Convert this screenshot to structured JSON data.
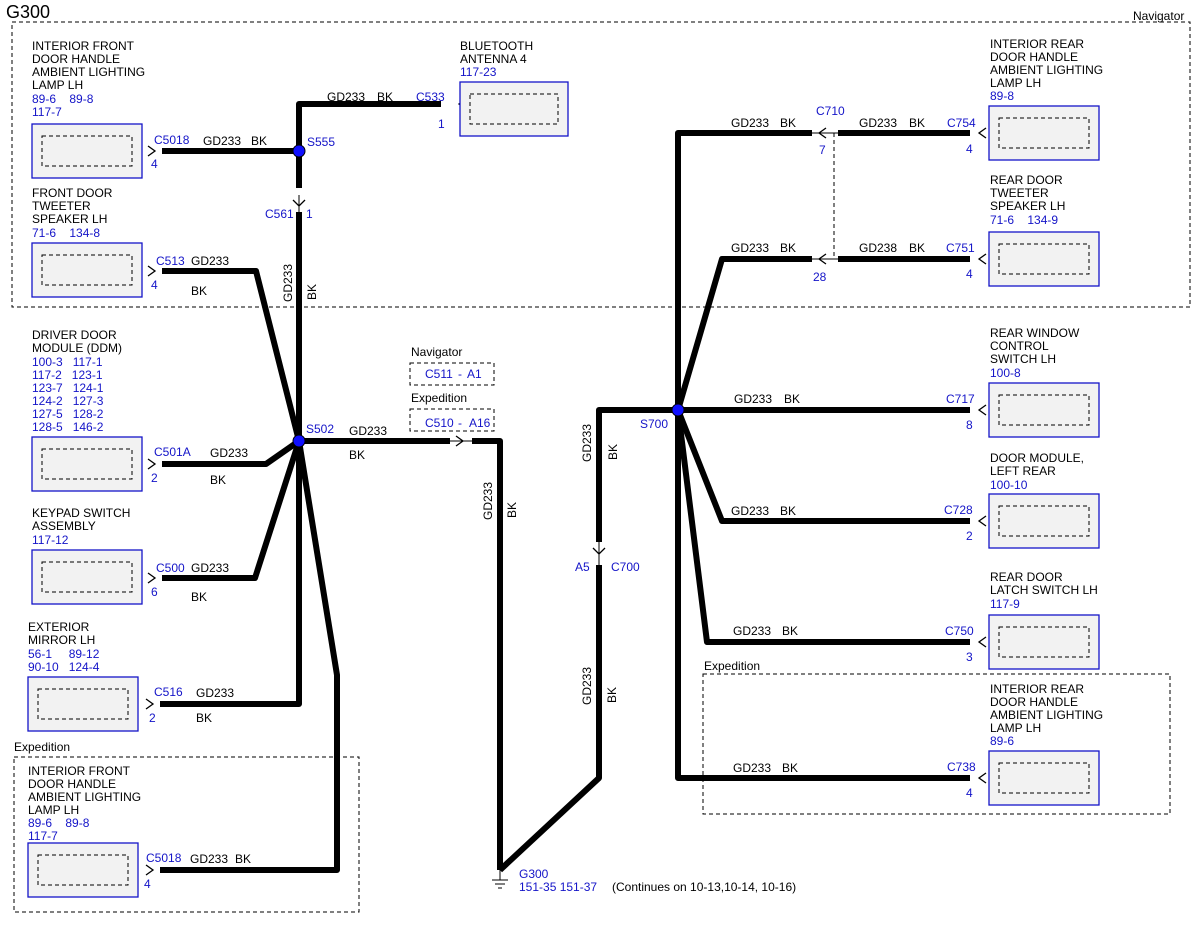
{
  "title": "G300",
  "region_labels": {
    "navigator_top": "Navigator",
    "expedition_left": "Expedition",
    "expedition_right": "Expedition"
  },
  "wire": {
    "circuit": "GD233",
    "color": "BK",
    "alt_circuit": "GD238"
  },
  "components": {
    "ifdh_lh": {
      "lines": [
        "INTERIOR FRONT",
        "DOOR HANDLE",
        "AMBIENT LIGHTING",
        "LAMP LH"
      ],
      "refs": [
        "89-6    89-8",
        "117-7"
      ],
      "connector": "C5018",
      "pin": "4"
    },
    "bt_antenna": {
      "lines": [
        "BLUETOOTH",
        "ANTENNA 4"
      ],
      "refs": [
        "117-23"
      ],
      "connector": "C533",
      "pin": "1"
    },
    "tweeter_lh": {
      "lines": [
        "FRONT DOOR",
        "TWEETER",
        "SPEAKER LH"
      ],
      "refs": [
        "71-6    134-8"
      ],
      "connector": "C513",
      "pin": "4"
    },
    "ddm": {
      "lines": [
        "DRIVER DOOR",
        "MODULE (DDM)"
      ],
      "refs": [
        "100-3   117-1",
        "117-2   123-1",
        "123-7   124-1",
        "124-2   127-3",
        "127-5   128-2",
        "128-5   146-2"
      ],
      "connector": "C501A",
      "pin": "2"
    },
    "keypad": {
      "lines": [
        "KEYPAD SWITCH",
        "ASSEMBLY"
      ],
      "refs": [
        "117-12"
      ],
      "connector": "C500",
      "pin": "6"
    },
    "mirror": {
      "lines": [
        "EXTERIOR",
        "MIRROR LH"
      ],
      "refs": [
        "56-1     89-12",
        "90-10   124-4"
      ],
      "connector": "C516",
      "pin": "2"
    },
    "ifdh_lh_exp": {
      "lines": [
        "INTERIOR FRONT",
        "DOOR HANDLE",
        "AMBIENT LIGHTING",
        "LAMP LH"
      ],
      "refs": [
        "89-6    89-8",
        "117-7"
      ],
      "connector": "C5018",
      "pin": "4"
    },
    "irdh_lh": {
      "lines": [
        "INTERIOR REAR",
        "DOOR HANDLE",
        "AMBIENT LIGHTING",
        "LAMP LH"
      ],
      "refs": [
        "89-8"
      ],
      "connector": "C754",
      "pin": "4"
    },
    "rear_tweeter": {
      "lines": [
        "REAR DOOR",
        "TWEETER",
        "SPEAKER LH"
      ],
      "refs": [
        "71-6    134-9"
      ],
      "connector": "C751",
      "pin": "4"
    },
    "rear_window": {
      "lines": [
        "REAR WINDOW",
        "CONTROL",
        "SWITCH LH"
      ],
      "refs": [
        "100-8"
      ],
      "connector": "C717",
      "pin": "8"
    },
    "door_module_lr": {
      "lines": [
        "DOOR MODULE,",
        "LEFT REAR"
      ],
      "refs": [
        "100-10"
      ],
      "connector": "C728",
      "pin": "2"
    },
    "rear_latch": {
      "lines": [
        "REAR DOOR",
        "LATCH SWITCH LH"
      ],
      "refs": [
        "117-9"
      ],
      "connector": "C750",
      "pin": "3"
    },
    "irdh_lh_exp": {
      "lines": [
        "INTERIOR REAR",
        "DOOR HANDLE",
        "AMBIENT LIGHTING",
        "LAMP LH"
      ],
      "refs": [
        "89-6"
      ],
      "connector": "C738",
      "pin": "4"
    }
  },
  "splices": {
    "s555": "S555",
    "s502": "S502",
    "s700": "S700"
  },
  "inline": {
    "c561": "C561",
    "c561_pin": "1",
    "c710": "C710",
    "c710_pin": "7",
    "c710_pin2": "28",
    "c700": "C700",
    "c700_pin": "A5",
    "nav_label": "Navigator",
    "nav_conn": "C511",
    "nav_pin": "A1",
    "exp_label": "Expedition",
    "exp_conn": "C510",
    "exp_pin": "A16",
    "dash": "-"
  },
  "ground": {
    "name": "G300",
    "refs": "151-35   151-37",
    "note": "(Continues on 10-13,10-14, 10-16)"
  },
  "colors": {
    "wire": "#000000",
    "label_blue": "#1414c8",
    "splice": "#1010ff",
    "box_fill": "#f2f2f2"
  }
}
